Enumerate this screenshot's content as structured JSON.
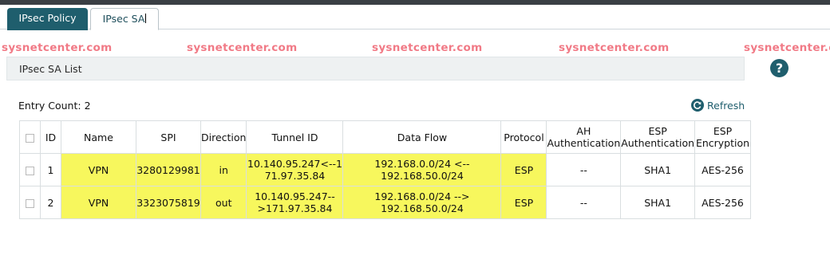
{
  "tabs": [
    {
      "label": "IPsec Policy",
      "active": false
    },
    {
      "label": "IPsec SA",
      "active": true
    }
  ],
  "watermark": "sysnetcenter.com",
  "section": {
    "title": "IPsec SA List"
  },
  "entry_count": {
    "label": "Entry Count:",
    "value": "2"
  },
  "refresh_label": "Refresh",
  "help_icon": "question-mark-icon",
  "table": {
    "headers": {
      "id": "ID",
      "name": "Name",
      "spi": "SPI",
      "direction": "Direction",
      "tunnel_id": "Tunnel ID",
      "data_flow": "Data Flow",
      "protocol": "Protocol",
      "ah_auth": [
        "AH",
        "Authentication"
      ],
      "esp_auth": [
        "ESP",
        "Authentication"
      ],
      "esp_enc": [
        "ESP",
        "Encryption"
      ]
    },
    "rows": [
      {
        "id": "1",
        "name": "VPN",
        "spi": "3280129981",
        "direction": "in",
        "tunnel_id": [
          "10.140.95.247<--1",
          "71.97.35.84"
        ],
        "data_flow": [
          "192.168.0.0/24 <--",
          "192.168.50.0/24"
        ],
        "protocol": "ESP",
        "ah_auth": "--",
        "esp_auth": "SHA1",
        "esp_enc": "AES-256"
      },
      {
        "id": "2",
        "name": "VPN",
        "spi": "3323075819",
        "direction": "out",
        "tunnel_id": [
          "10.140.95.247--",
          ">171.97.35.84"
        ],
        "data_flow": [
          "192.168.0.0/24 -->",
          "192.168.50.0/24"
        ],
        "protocol": "ESP",
        "ah_auth": "--",
        "esp_auth": "SHA1",
        "esp_enc": "AES-256"
      }
    ]
  },
  "colors": {
    "accent": "#1f5e6d",
    "highlight": "#f7f75d",
    "watermark": "#f17a86"
  }
}
